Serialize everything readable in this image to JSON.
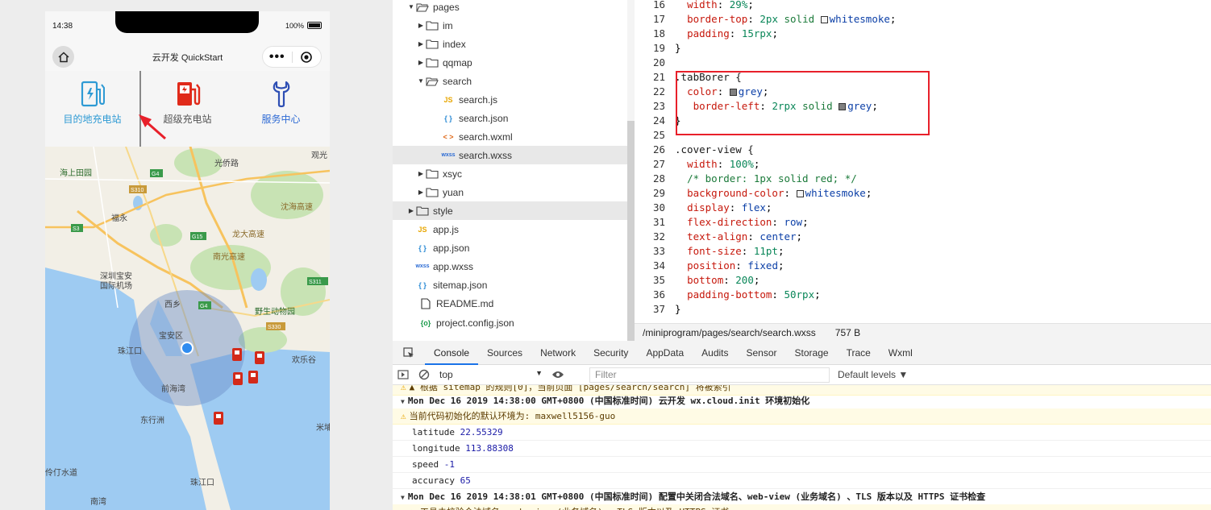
{
  "simulator": {
    "status": {
      "time": "14:38",
      "battery": "100%"
    },
    "navbar": {
      "title": "云开发 QuickStart",
      "more": "•••"
    },
    "tabs": [
      {
        "label": "目的地充电站",
        "color": "#2e9ad4",
        "icon": "charging-station-icon"
      },
      {
        "label": "超级充电站",
        "color": "#555555",
        "icon": "super-charging-icon"
      },
      {
        "label": "服务中心",
        "color": "#2e6ad4",
        "icon": "wrench-icon"
      }
    ],
    "map": {
      "labels": [
        "观光",
        "光侨路",
        "海上田园",
        "福永",
        "沈海高速",
        "深圳宝安",
        "国际机场",
        "龙大高速",
        "南光高速",
        "西乡",
        "野生动物园",
        "宝安区",
        "珠江口",
        "前海湾",
        "欢乐谷",
        "东行洲",
        "伶仃水道",
        "珠江口",
        "米埔",
        "南湾",
        "S3",
        "G4",
        "G15",
        "S310",
        "S311",
        "S330",
        "G4"
      ]
    }
  },
  "filetree": {
    "items": [
      {
        "label": "pages",
        "type": "folder",
        "open": true,
        "depth": 1
      },
      {
        "label": "im",
        "type": "folder",
        "open": false,
        "depth": 2
      },
      {
        "label": "index",
        "type": "folder",
        "open": false,
        "depth": 2
      },
      {
        "label": "qqmap",
        "type": "folder",
        "open": false,
        "depth": 2
      },
      {
        "label": "search",
        "type": "folder",
        "open": true,
        "depth": 2
      },
      {
        "label": "search.js",
        "type": "js",
        "depth": 3
      },
      {
        "label": "search.json",
        "type": "json",
        "depth": 3
      },
      {
        "label": "search.wxml",
        "type": "wxml",
        "depth": 3
      },
      {
        "label": "search.wxss",
        "type": "wxss",
        "depth": 3,
        "selected": true
      },
      {
        "label": "xsyc",
        "type": "folder",
        "open": false,
        "depth": 2
      },
      {
        "label": "yuan",
        "type": "folder",
        "open": false,
        "depth": 2
      },
      {
        "label": "style",
        "type": "folder",
        "open": false,
        "depth": 1,
        "selected": true
      },
      {
        "label": "app.js",
        "type": "js",
        "depth": 1
      },
      {
        "label": "app.json",
        "type": "json",
        "depth": 1
      },
      {
        "label": "app.wxss",
        "type": "wxss",
        "depth": 1
      },
      {
        "label": "sitemap.json",
        "type": "json",
        "depth": 1
      },
      {
        "label": "README.md",
        "type": "file",
        "depth": 0
      },
      {
        "label": "project.config.json",
        "type": "config",
        "depth": 0
      }
    ],
    "icon_text": {
      "js": "JS",
      "json": "{ }",
      "wxml": "< >",
      "wxss": "wxss",
      "config": "{o}"
    }
  },
  "editor": {
    "lines": [
      {
        "n": "16",
        "parts": [
          [
            "  ",
            ""
          ],
          [
            "width",
            "prop"
          ],
          [
            ": ",
            ""
          ],
          [
            "29%",
            "num"
          ],
          [
            ";",
            ""
          ]
        ]
      },
      {
        "n": "17",
        "parts": [
          [
            "  ",
            ""
          ],
          [
            "border-top",
            "prop"
          ],
          [
            ": ",
            ""
          ],
          [
            "2px",
            "num"
          ],
          [
            " solid ",
            "val"
          ],
          [
            "SWATCH:#f5f5f5",
            ""
          ],
          [
            "whitesmoke",
            "kw"
          ],
          [
            ";",
            ""
          ]
        ]
      },
      {
        "n": "18",
        "parts": [
          [
            "  ",
            ""
          ],
          [
            "padding",
            "prop"
          ],
          [
            ": ",
            ""
          ],
          [
            "15rpx",
            "num"
          ],
          [
            ";",
            ""
          ]
        ]
      },
      {
        "n": "19",
        "parts": [
          [
            "}",
            ""
          ]
        ]
      },
      {
        "n": "20",
        "parts": [
          [
            "",
            ""
          ]
        ]
      },
      {
        "n": "21",
        "parts": [
          [
            ".tabBorer {",
            "sel"
          ]
        ]
      },
      {
        "n": "22",
        "parts": [
          [
            "  ",
            ""
          ],
          [
            "color",
            "prop"
          ],
          [
            ": ",
            ""
          ],
          [
            "SWATCH:#808080",
            ""
          ],
          [
            "grey",
            "kw"
          ],
          [
            ";",
            ""
          ]
        ]
      },
      {
        "n": "23",
        "parts": [
          [
            "   ",
            ""
          ],
          [
            "border-left",
            "prop"
          ],
          [
            ": ",
            ""
          ],
          [
            "2rpx",
            "num"
          ],
          [
            " solid ",
            "val"
          ],
          [
            "SWATCH:#808080",
            ""
          ],
          [
            "grey",
            "kw"
          ],
          [
            ";",
            ""
          ]
        ]
      },
      {
        "n": "24",
        "parts": [
          [
            "}",
            ""
          ]
        ]
      },
      {
        "n": "25",
        "parts": [
          [
            "",
            ""
          ]
        ]
      },
      {
        "n": "26",
        "parts": [
          [
            ".cover-view {",
            "sel"
          ]
        ]
      },
      {
        "n": "27",
        "parts": [
          [
            "  ",
            ""
          ],
          [
            "width",
            "prop"
          ],
          [
            ": ",
            ""
          ],
          [
            "100%",
            "num"
          ],
          [
            ";",
            ""
          ]
        ]
      },
      {
        "n": "28",
        "parts": [
          [
            "  ",
            ""
          ],
          [
            "/* border: 1px solid red; */",
            "com"
          ]
        ]
      },
      {
        "n": "29",
        "parts": [
          [
            "  ",
            ""
          ],
          [
            "background-color",
            "prop"
          ],
          [
            ": ",
            ""
          ],
          [
            "SWATCH:#f5f5f5",
            ""
          ],
          [
            "whitesmoke",
            "kw"
          ],
          [
            ";",
            ""
          ]
        ]
      },
      {
        "n": "30",
        "parts": [
          [
            "  ",
            ""
          ],
          [
            "display",
            "prop"
          ],
          [
            ": ",
            ""
          ],
          [
            "flex",
            "kw"
          ],
          [
            ";",
            ""
          ]
        ]
      },
      {
        "n": "31",
        "parts": [
          [
            "  ",
            ""
          ],
          [
            "flex-direction",
            "prop"
          ],
          [
            ": ",
            ""
          ],
          [
            "row",
            "kw"
          ],
          [
            ";",
            ""
          ]
        ]
      },
      {
        "n": "32",
        "parts": [
          [
            "  ",
            ""
          ],
          [
            "text-align",
            "prop"
          ],
          [
            ": ",
            ""
          ],
          [
            "center",
            "kw"
          ],
          [
            ";",
            ""
          ]
        ]
      },
      {
        "n": "33",
        "parts": [
          [
            "  ",
            ""
          ],
          [
            "font-size",
            "prop"
          ],
          [
            ": ",
            ""
          ],
          [
            "11pt",
            "num"
          ],
          [
            ";",
            ""
          ]
        ]
      },
      {
        "n": "34",
        "parts": [
          [
            "  ",
            ""
          ],
          [
            "position",
            "prop"
          ],
          [
            ": ",
            ""
          ],
          [
            "fixed",
            "kw"
          ],
          [
            ";",
            ""
          ]
        ]
      },
      {
        "n": "35",
        "parts": [
          [
            "  ",
            ""
          ],
          [
            "bottom",
            "prop"
          ],
          [
            ": ",
            ""
          ],
          [
            "200",
            "num"
          ],
          [
            ";",
            ""
          ]
        ]
      },
      {
        "n": "36",
        "parts": [
          [
            "  ",
            ""
          ],
          [
            "padding-bottom",
            "prop"
          ],
          [
            ": ",
            ""
          ],
          [
            "50rpx",
            "num"
          ],
          [
            ";",
            ""
          ]
        ]
      },
      {
        "n": "37",
        "parts": [
          [
            "}",
            ""
          ]
        ]
      }
    ],
    "status": {
      "path": "/miniprogram/pages/search/search.wxss",
      "size": "757 B"
    }
  },
  "devtools": {
    "tabs": [
      "Console",
      "Sources",
      "Network",
      "Security",
      "AppData",
      "Audits",
      "Sensor",
      "Storage",
      "Trace",
      "Wxml"
    ],
    "active_tab": "Console",
    "context": "top",
    "filter_placeholder": "Filter",
    "levels": "Default levels ▼",
    "console": [
      {
        "type": "warn",
        "text": "▲ 根据 sitemap 的规则[0]，当前页面 [pages/search/search] 将被索引"
      },
      {
        "type": "group",
        "text": "Mon Dec 16 2019 14:38:00 GMT+0800 (中国标准时间) 云开发 wx.cloud.init 环境初始化"
      },
      {
        "type": "warn",
        "text": "当前代码初始化的默认环境为: maxwell5156-guo"
      },
      {
        "type": "kv",
        "key": "latitude",
        "value": "22.55329"
      },
      {
        "type": "kv",
        "key": "longitude",
        "value": "113.88308"
      },
      {
        "type": "kv",
        "key": "speed",
        "value": "-1"
      },
      {
        "type": "kv",
        "key": "accuracy",
        "value": "65"
      },
      {
        "type": "group",
        "text": "Mon Dec 16 2019 14:38:01 GMT+0800 (中国标准时间) 配置中关闭合法域名、web-view (业务域名) 、TLS 版本以及 HTTPS 证书检查"
      },
      {
        "type": "warn",
        "text": "▲ 工具未校验合法域名、web-view (业务域名) 、TLS 版本以及 HTTPS 证书"
      }
    ]
  }
}
